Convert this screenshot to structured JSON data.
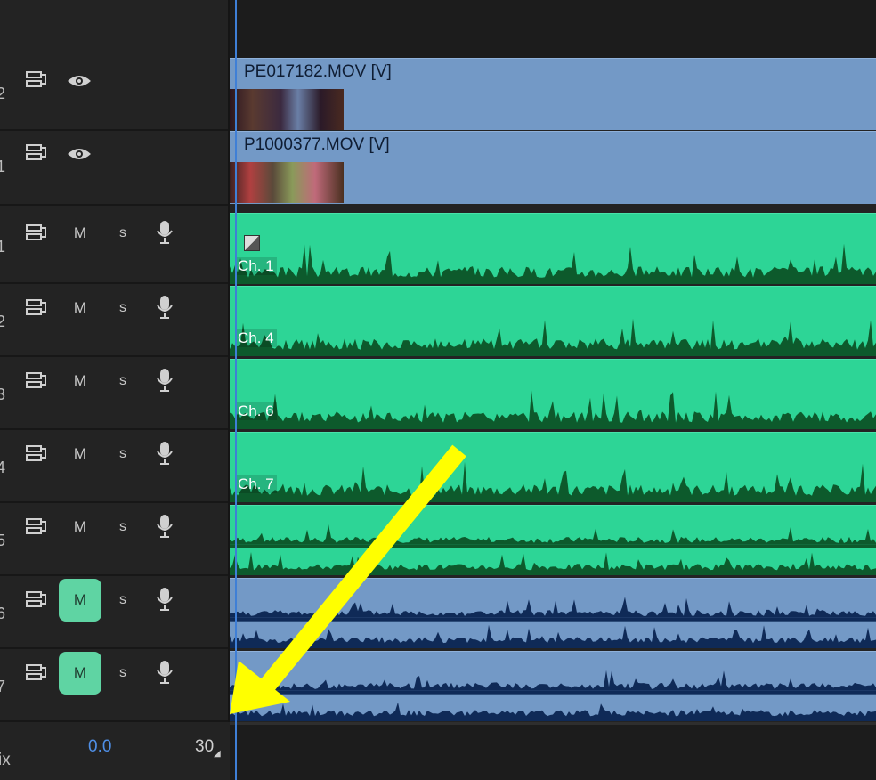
{
  "tracks": {
    "video": [
      {
        "num": "2",
        "clip": "PE017182.MOV [V]"
      },
      {
        "num": "1",
        "clip": "P1000377.MOV [V]"
      }
    ],
    "audio": [
      {
        "num": "1",
        "label": "Ch. 1"
      },
      {
        "num": "2",
        "label": "Ch. 4"
      },
      {
        "num": "3",
        "label": "Ch. 6"
      },
      {
        "num": "4",
        "label": "Ch. 7"
      },
      {
        "num": "5",
        "label": ""
      },
      {
        "num": "6",
        "label": ""
      },
      {
        "num": "7",
        "label": ""
      }
    ],
    "mute_label": "M",
    "solo_label": "S"
  },
  "mix": {
    "label": "ix",
    "value": "0.0",
    "end_value": "30"
  },
  "colors": {
    "video_clip": "#7399c6",
    "audio_clip": "#2dd596",
    "waveform_green": "#0d5a2c",
    "waveform_blue": "#0f2a57",
    "mute_active": "#5fd4a3",
    "playhead": "#3f7fd6",
    "arrow": "#ffff00"
  },
  "icons": [
    "track-output-icon",
    "eye-icon",
    "microphone-icon"
  ]
}
